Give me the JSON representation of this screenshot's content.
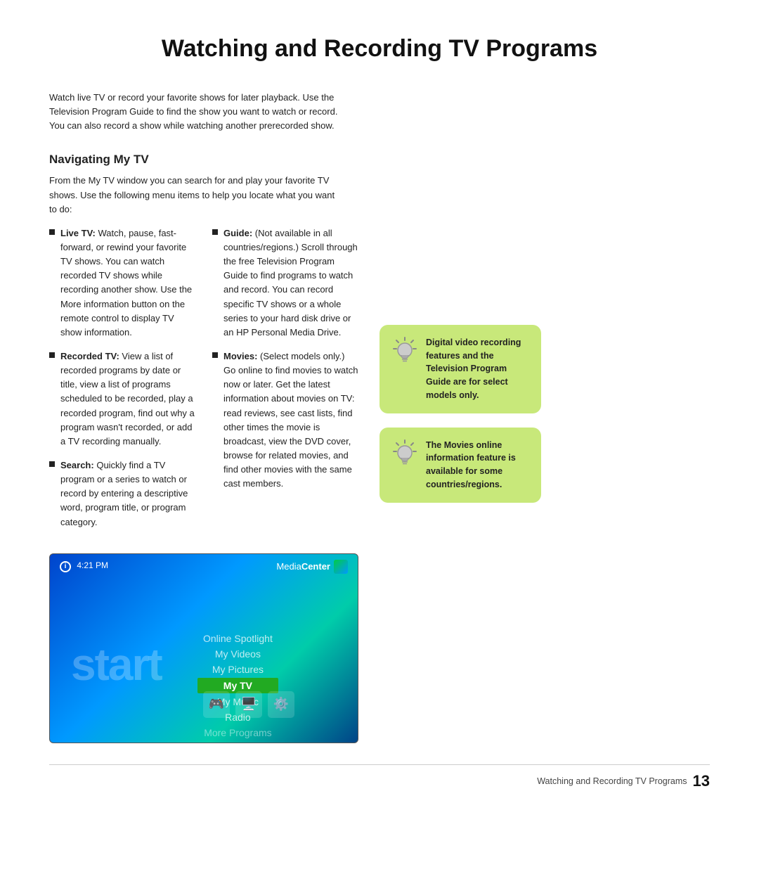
{
  "page": {
    "title": "Watching and Recording TV Programs",
    "intro": "Watch live TV or record your favorite shows for later playback. Use the Television Program Guide to find the show you want to watch or record. You can also record a show while watching another prerecorded show.",
    "section1": {
      "heading": "Navigating My TV",
      "intro": "From the My TV window you can search for and play your favorite TV shows. Use the following menu items to help you locate what you want to do:"
    },
    "bullets_left": [
      {
        "label": "Live TV:",
        "text": "Watch, pause, fast-forward, or rewind your favorite TV shows. You can watch recorded TV shows while recording another show. Use the More information button on the remote control to display TV show information."
      },
      {
        "label": "Recorded TV:",
        "text": "View a list of recorded programs by date or title, view a list of programs scheduled to be recorded, play a recorded program, find out why a program wasn't recorded, or add a TV recording manually."
      },
      {
        "label": "Search:",
        "text": "Quickly find a TV program or a series to watch or record by entering a descriptive word, program title, or program category."
      }
    ],
    "bullets_right": [
      {
        "label": "Guide:",
        "text": "(Not available in all countries/regions.) Scroll through the free Television Program Guide to find programs to watch and record. You can record specific TV shows or a whole series to your hard disk drive or an HP Personal Media Drive."
      },
      {
        "label": "Movies:",
        "text": "(Select models only.) Go online to find movies to watch now or later. Get the latest information about movies on TV: read reviews, see cast lists, find other times the movie is broadcast, view the DVD cover, browse for related movies, and find other movies with the same cast members."
      }
    ],
    "callout1": {
      "text": "Digital video recording features and the Television Program Guide are for select models only."
    },
    "callout2": {
      "text": "The Movies online information feature is available for some countries/regions."
    },
    "screenshot": {
      "time": "4:21 PM",
      "brand": "MediaCenter",
      "start_text": "start",
      "menu_items": [
        {
          "label": "Online Spotlight",
          "active": false
        },
        {
          "label": "My Videos",
          "active": false
        },
        {
          "label": "My Pictures",
          "active": false
        },
        {
          "label": "My TV",
          "active": true
        },
        {
          "label": "My Music",
          "active": false
        },
        {
          "label": "Radio",
          "active": false
        },
        {
          "label": "More Programs",
          "active": false
        }
      ]
    },
    "footer": {
      "label": "Watching and Recording TV Programs",
      "page_number": "13"
    }
  }
}
